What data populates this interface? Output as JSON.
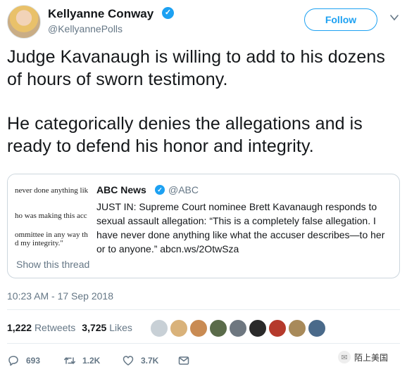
{
  "author": {
    "name": "Kellyanne Conway",
    "handle": "@KellyannePolls",
    "verified": true
  },
  "follow_label": "Follow",
  "tweet": {
    "paragraphs": [
      "Judge Kavanaugh is willing to add to his dozens of hours of sworn testimony.",
      "He categorically denies the allegations and is ready to defend his honor and integrity."
    ]
  },
  "quote": {
    "thumb_lines": [
      "never done anything lik",
      "ho was making this acc",
      "ommittee in any way th",
      "d my integrity.\""
    ],
    "name": "ABC News",
    "handle": "@ABC",
    "text": "JUST IN: Supreme Court nominee Brett Kavanaugh responds to sexual assault allegation: “This is a completely false allegation. I have never done anything like what the accuser describes—to her or to anyone.” abcn.ws/2OtwSza",
    "show_thread": "Show this thread"
  },
  "timestamp": "10:23 AM - 17 Sep 2018",
  "stats": {
    "retweets_count": "1,222",
    "retweets_label": "Retweets",
    "likes_count": "3,725",
    "likes_label": "Likes"
  },
  "actions": {
    "replies": "693",
    "retweets": "1.2K",
    "likes": "3.7K"
  },
  "watermark": "陌上美国",
  "colors": {
    "accent": "#1da1f2",
    "text": "#14171a",
    "muted": "#657786",
    "border": "#ccd6dd"
  }
}
